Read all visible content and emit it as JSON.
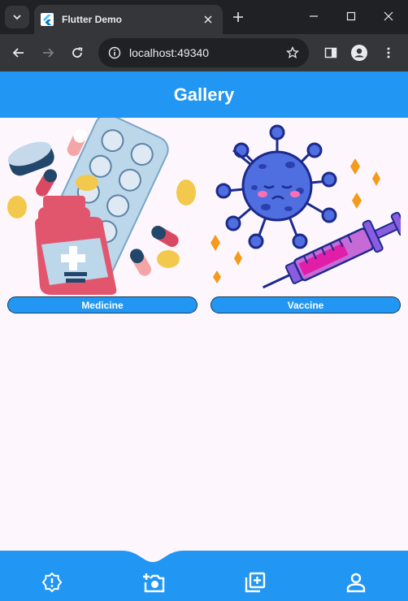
{
  "browser": {
    "tab_title": "Flutter Demo",
    "url": "localhost:49340",
    "icons": {
      "tab_search": "chevron-down-icon",
      "favicon": "flutter-icon",
      "tab_close": "close-icon",
      "new_tab": "plus-icon",
      "minimize": "minimize-icon",
      "maximize": "maximize-icon",
      "close_window": "close-icon",
      "back": "arrow-left-icon",
      "forward": "arrow-right-icon",
      "reload": "reload-icon",
      "site_info": "info-icon",
      "bookmark": "star-icon",
      "side_panel": "side-panel-icon",
      "profile": "profile-icon",
      "menu": "kebab-menu-icon"
    }
  },
  "app": {
    "title": "Gallery",
    "accent_color": "#2196f3",
    "background_color": "#fdf7fd",
    "items": [
      {
        "label": "Medicine",
        "illustration": "medicine-illustration"
      },
      {
        "label": "Vaccine",
        "illustration": "vaccine-illustration"
      }
    ],
    "bottom_nav": [
      {
        "icon": "alert-badge-icon"
      },
      {
        "icon": "add-photo-icon"
      },
      {
        "icon": "add-library-icon"
      },
      {
        "icon": "person-icon"
      }
    ]
  }
}
